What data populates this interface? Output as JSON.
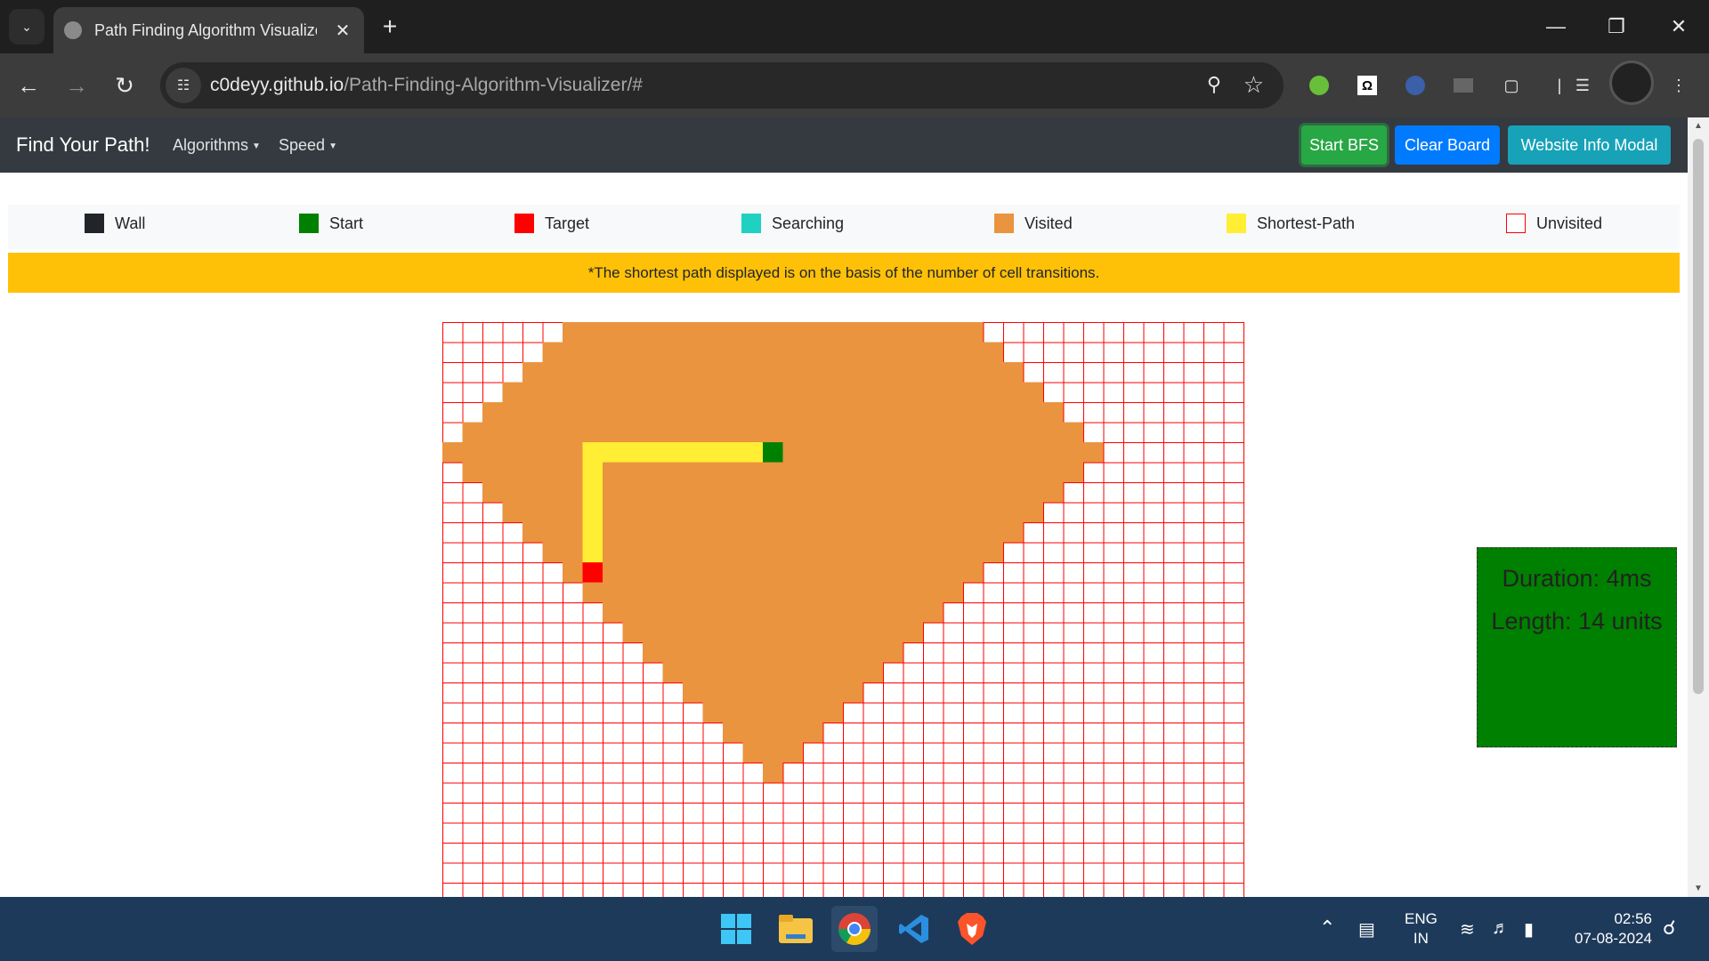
{
  "browser": {
    "tab_title": "Path Finding Algorithm Visualizer",
    "url_domain": "c0deyy.github.io",
    "url_path": "/Path-Finding-Algorithm-Visualizer/#"
  },
  "navbar": {
    "brand": "Find Your Path!",
    "algorithms_label": "Algorithms",
    "speed_label": "Speed",
    "start_button": "Start BFS",
    "clear_button": "Clear Board",
    "info_button": "Website Info Modal"
  },
  "legend": [
    {
      "label": "Wall",
      "color": "#212529"
    },
    {
      "label": "Start",
      "color": "#008000"
    },
    {
      "label": "Target",
      "color": "#ff0000"
    },
    {
      "label": "Searching",
      "color": "#1fd1c1"
    },
    {
      "label": "Visited",
      "color": "#ea9440"
    },
    {
      "label": "Shortest-Path",
      "color": "#ffee33"
    },
    {
      "label": "Unvisited",
      "color": "#ffffff"
    }
  ],
  "alert_text": "*The shortest path displayed is on the basis of the number of cell transitions.",
  "grid": {
    "cols": 40,
    "start": {
      "row": 6,
      "col": 16
    },
    "target": {
      "row": 12,
      "col": 7
    },
    "visited_radius": 16,
    "visited_color": "#ea9440",
    "path_color": "#ffee33",
    "unvisited_border": "#ff0000"
  },
  "result": {
    "duration": "Duration: 4ms",
    "length": "Length: 14 units"
  },
  "taskbar": {
    "language": "ENG",
    "region": "IN",
    "time": "02:56",
    "date": "07-08-2024"
  }
}
